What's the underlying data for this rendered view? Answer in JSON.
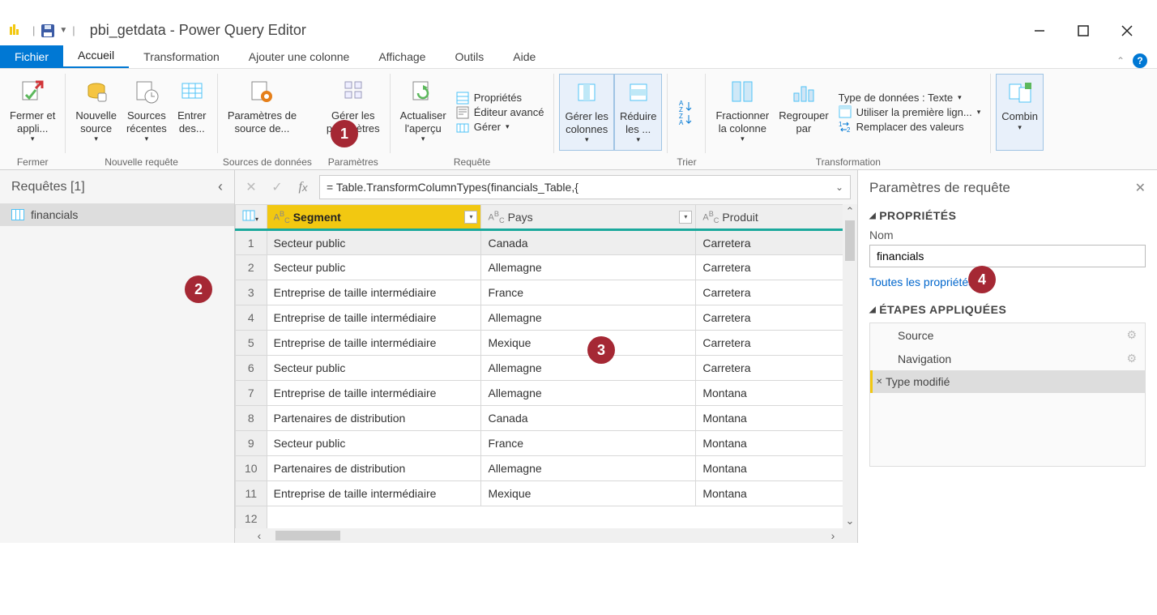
{
  "titlebar": {
    "title": "pbi_getdata - Power Query Editor"
  },
  "tabs": {
    "file": "Fichier",
    "home": "Accueil",
    "transform": "Transformation",
    "addcol": "Ajouter une colonne",
    "view": "Affichage",
    "tools": "Outils",
    "help": "Aide"
  },
  "ribbon": {
    "close": {
      "label": "Fermer et\nappli...",
      "group": "Fermer"
    },
    "newquery": {
      "newsource": "Nouvelle\nsource",
      "recent": "Sources\nrécentes",
      "enter": "Entrer\ndes...",
      "group": "Nouvelle requête"
    },
    "datasources": {
      "params": "Paramètres de\nsource de...",
      "group": "Sources de données"
    },
    "parameters": {
      "manage": "Gérer les\nparamètres",
      "group": "Paramètres"
    },
    "query": {
      "refresh": "Actualiser\nl'aperçu",
      "props": "Propriétés",
      "adv": "Éditeur avancé",
      "manage": "Gérer",
      "group": "Requête"
    },
    "columns": {
      "manage": "Gérer les\ncolonnes",
      "reduce": "Réduire\nles ...",
      "group": ""
    },
    "sort": {
      "group": "Trier"
    },
    "transform": {
      "split": "Fractionner\nla colonne",
      "group": "Regrouper\npar",
      "datatype": "Type de données : Texte",
      "firstrow": "Utiliser la première lign...",
      "replace": "Remplacer des valeurs",
      "grouplabel": "Transformation"
    },
    "combine": {
      "label": "Combin"
    }
  },
  "queries": {
    "header": "Requêtes [1]",
    "items": [
      "financials"
    ]
  },
  "formula": "= Table.TransformColumnTypes(financials_Table,{",
  "grid": {
    "columns": [
      {
        "type": "ABC",
        "name": "Segment",
        "selected": true
      },
      {
        "type": "ABC",
        "name": "Pays",
        "selected": false
      },
      {
        "type": "ABC",
        "name": "Produit",
        "selected": false
      }
    ],
    "rows": [
      [
        "Secteur public",
        "Canada",
        "Carretera"
      ],
      [
        "Secteur public",
        "Allemagne",
        "Carretera"
      ],
      [
        "Entreprise de taille intermédiaire",
        "France",
        "Carretera"
      ],
      [
        "Entreprise de taille intermédiaire",
        "Allemagne",
        "Carretera"
      ],
      [
        "Entreprise de taille intermédiaire",
        "Mexique",
        "Carretera"
      ],
      [
        "Secteur public",
        "Allemagne",
        "Carretera"
      ],
      [
        "Entreprise de taille intermédiaire",
        "Allemagne",
        "Montana"
      ],
      [
        "Partenaires de distribution",
        "Canada",
        "Montana"
      ],
      [
        "Secteur public",
        "France",
        "Montana"
      ],
      [
        "Partenaires de distribution",
        "Allemagne",
        "Montana"
      ],
      [
        "Entreprise de taille intermédiaire",
        "Mexique",
        "Montana"
      ]
    ]
  },
  "props": {
    "title": "Paramètres de requête",
    "properties": "PROPRIÉTÉS",
    "nameLabel": "Nom",
    "nameValue": "financials",
    "allprops": "Toutes les propriétés",
    "stepsTitle": "ÉTAPES APPLIQUÉES",
    "steps": [
      {
        "name": "Source",
        "gear": true,
        "selected": false
      },
      {
        "name": "Navigation",
        "gear": true,
        "selected": false
      },
      {
        "name": "Type modifié",
        "gear": false,
        "selected": true
      }
    ]
  },
  "callouts": {
    "1": "1",
    "2": "2",
    "3": "3",
    "4": "4"
  }
}
